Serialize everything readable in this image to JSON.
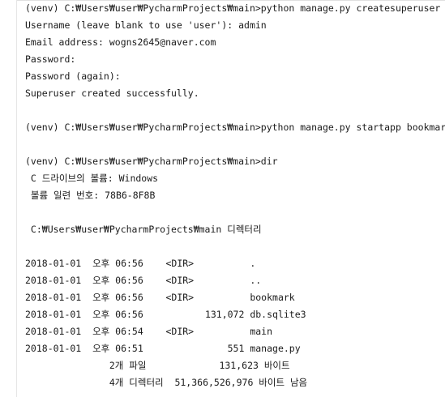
{
  "console": {
    "lines": [
      "(venv) C:₩Users₩user₩PycharmProjects₩main>python manage.py createsuperuser",
      "Username (leave blank to use 'user'): admin",
      "Email address: wogns2645@naver.com",
      "Password:",
      "Password (again):",
      "Superuser created successfully.",
      "",
      "(venv) C:₩Users₩user₩PycharmProjects₩main>python manage.py startapp bookmark",
      "",
      "(venv) C:₩Users₩user₩PycharmProjects₩main>dir",
      " C 드라이브의 볼륨: Windows",
      " 볼륨 일련 번호: 78B6-8F8B",
      "",
      " C:₩Users₩user₩PycharmProjects₩main 디렉터리",
      "",
      "2018-01-01  오후 06:56    <DIR>          .",
      "2018-01-01  오후 06:56    <DIR>          ..",
      "2018-01-01  오후 06:56    <DIR>          bookmark",
      "2018-01-01  오후 06:56           131,072 db.sqlite3",
      "2018-01-01  오후 06:54    <DIR>          main",
      "2018-01-01  오후 06:51               551 manage.py",
      "               2개 파일             131,623 바이트",
      "               4개 디렉터리  51,366,526,976 바이트 남음"
    ]
  }
}
